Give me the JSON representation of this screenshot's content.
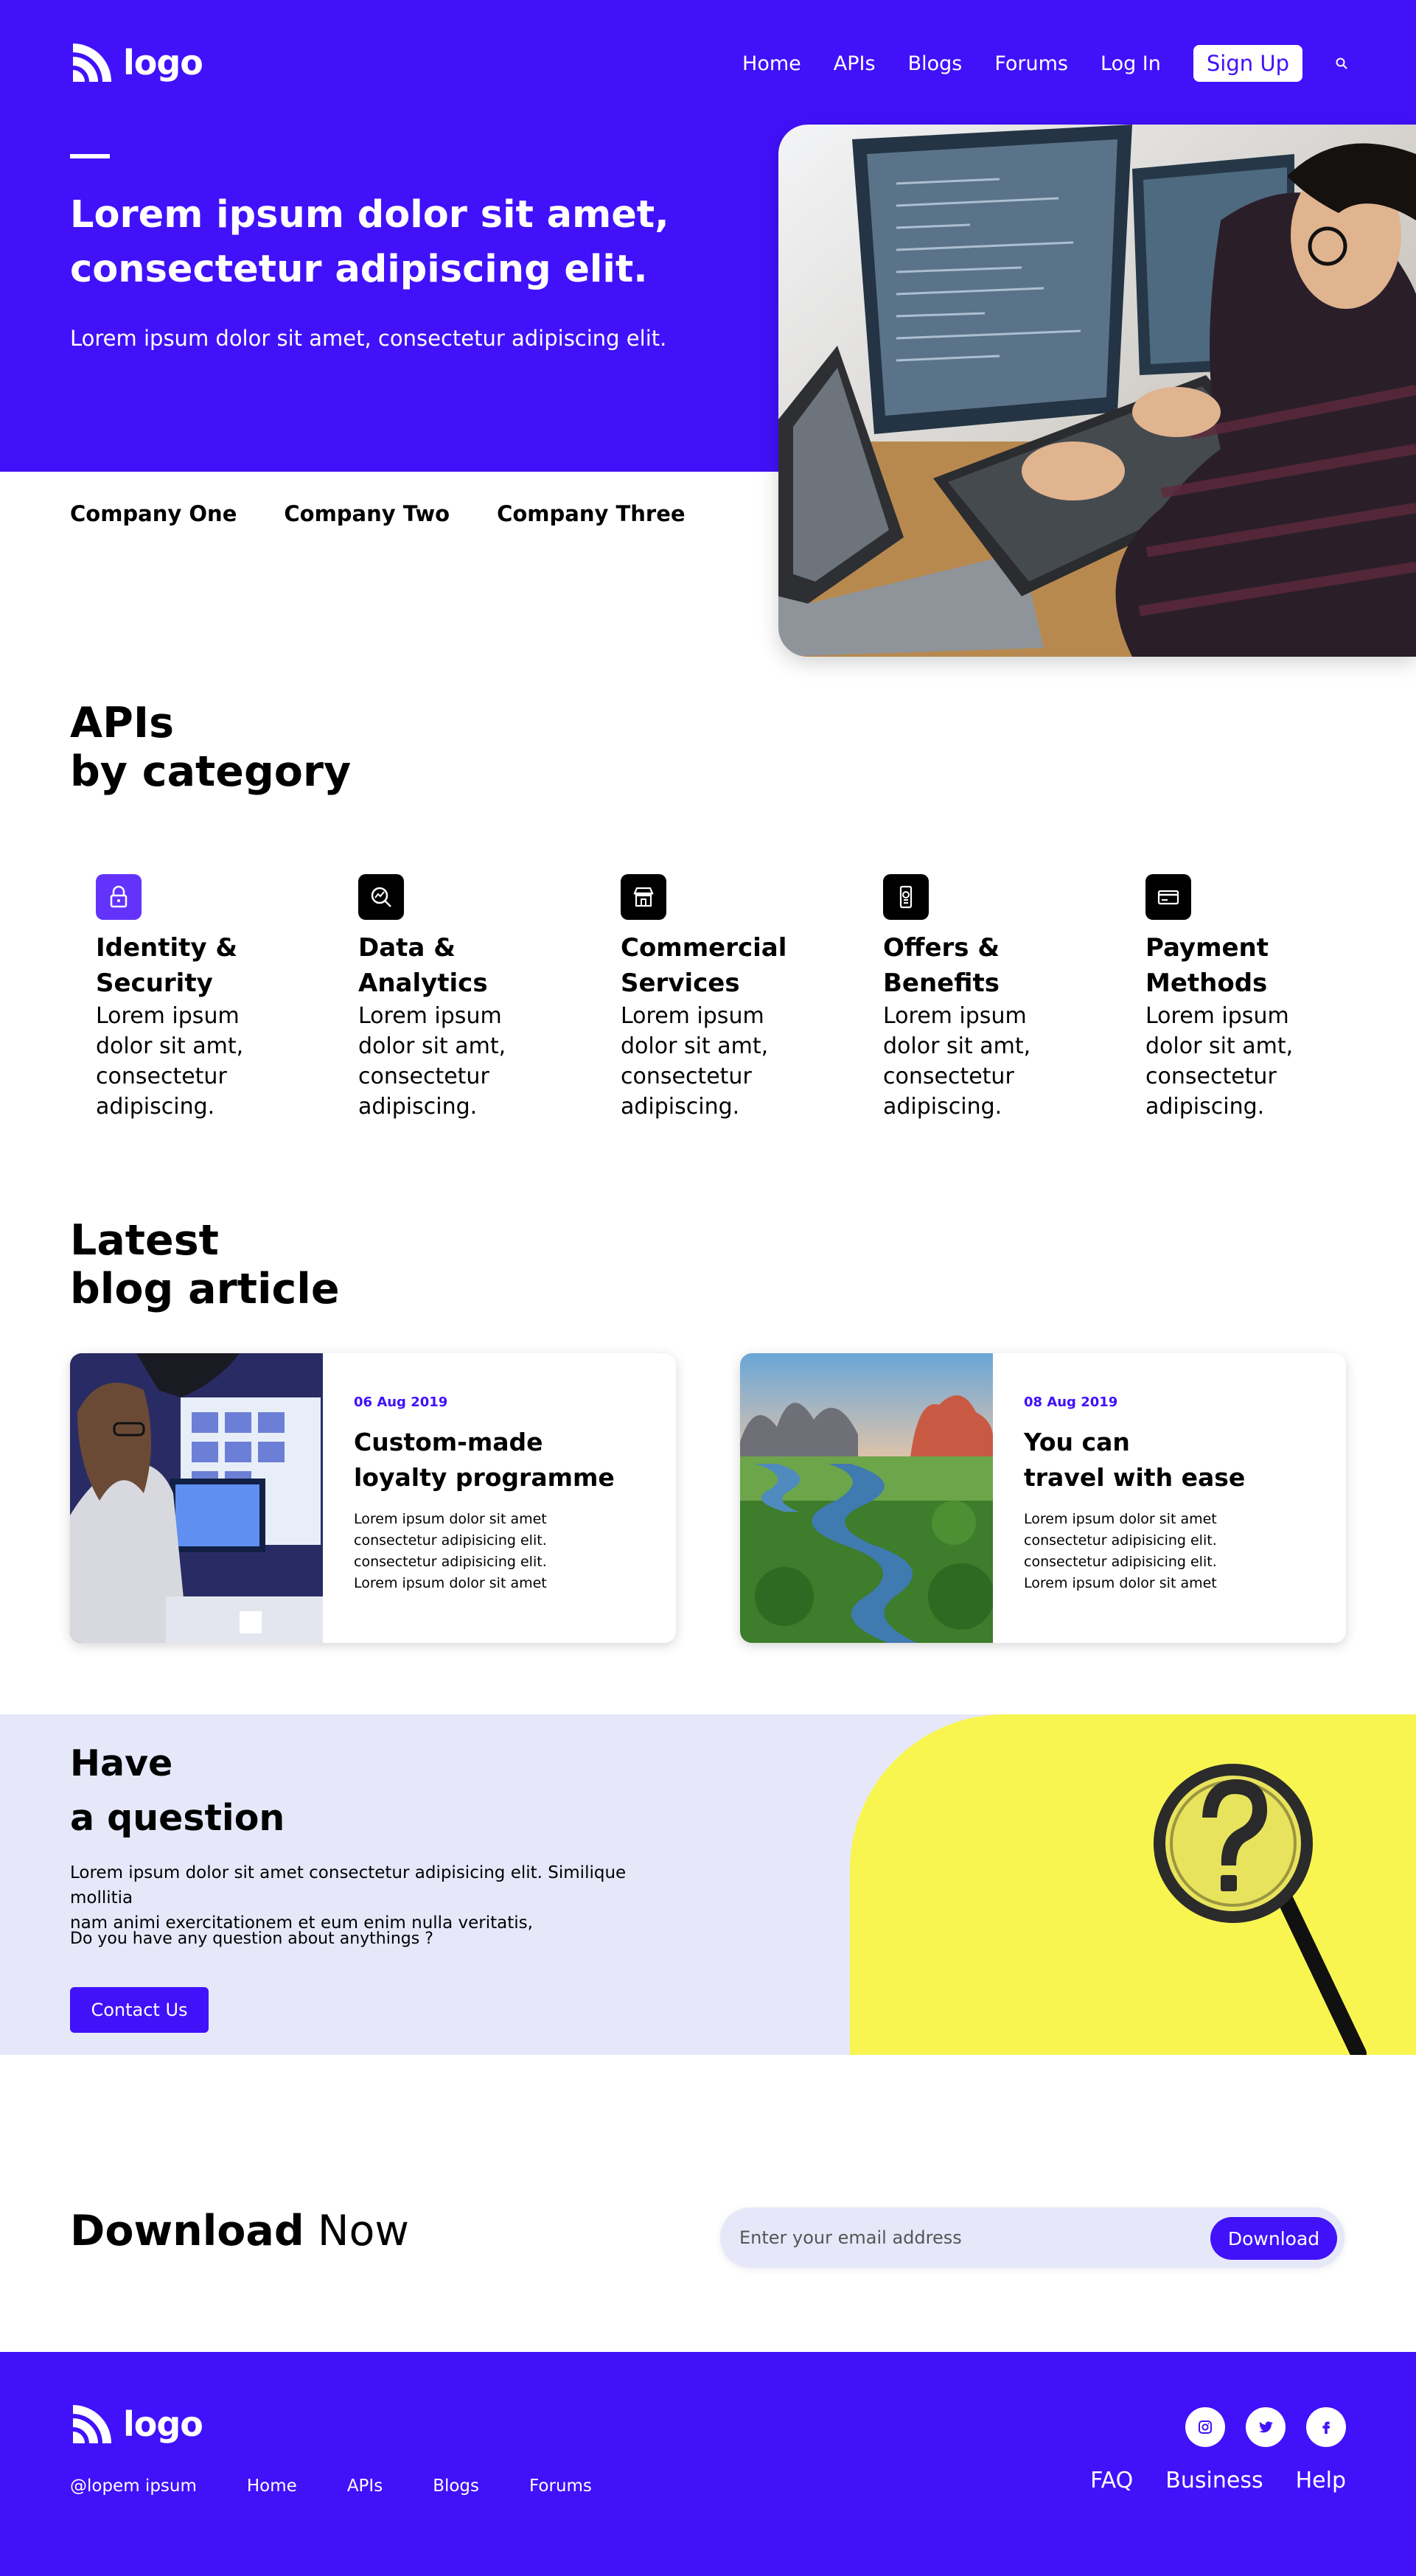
{
  "colors": {
    "brand": "#4111fa",
    "brand_light": "#6433fb",
    "pale": "#e6e8fa",
    "yellow": "#f8f551",
    "white": "#ffffff"
  },
  "header": {
    "logo_text": "logo",
    "nav": [
      "Home",
      "APIs",
      "Blogs",
      "Forums",
      "Log In"
    ],
    "signup": "Sign Up",
    "search_icon": "search-icon"
  },
  "hero": {
    "title_line1": "Lorem ipsum dolor sit amet,",
    "title_line2": "consectetur adipiscing elit.",
    "subtitle": "Lorem ipsum dolor sit amet, consectetur adipiscing elit.",
    "companies": [
      "Company One",
      "Company Two",
      "Company Three"
    ]
  },
  "apis": {
    "title_line1": "APIs",
    "title_line2": "by category",
    "categories": [
      {
        "icon": "lock-icon",
        "title_line1": "Identity &",
        "title_line2": "Security",
        "desc": [
          "Lorem ipsum",
          "dolor sit amt,",
          "consectetur",
          "adipiscing."
        ]
      },
      {
        "icon": "analytics-icon",
        "title_line1": "Data &",
        "title_line2": "Analytics",
        "desc": [
          "Lorem ipsum",
          "dolor sit amt,",
          "consectetur",
          "adipiscing."
        ]
      },
      {
        "icon": "store-icon",
        "title_line1": "Commercial",
        "title_line2": "Services",
        "desc": [
          "Lorem ipsum",
          "dolor sit amt,",
          "consectetur",
          "adipiscing."
        ]
      },
      {
        "icon": "mobile-offer-icon",
        "title_line1": "Offers &",
        "title_line2": "Benefits",
        "desc": [
          "Lorem ipsum",
          "dolor sit amt,",
          "consectetur",
          "adipiscing."
        ]
      },
      {
        "icon": "credit-card-icon",
        "title_line1": "Payment",
        "title_line2": "Methods",
        "desc": [
          "Lorem ipsum",
          "dolor sit amt,",
          "consectetur",
          "adipiscing."
        ]
      }
    ]
  },
  "blog": {
    "title_line1": "Latest",
    "title_line2": "blog article",
    "cards": [
      {
        "date": "06 Aug 2019",
        "title_line1": "Custom-made",
        "title_line2": "loyalty programme",
        "text": [
          "Lorem ipsum dolor sit amet",
          "consectetur adipisicing elit.",
          "consectetur adipisicing elit.",
          "Lorem ipsum dolor sit amet"
        ]
      },
      {
        "date": "08 Aug 2019",
        "title_line1": "You can",
        "title_line2": "travel with ease",
        "text": [
          "Lorem ipsum dolor sit amet",
          "consectetur adipisicing elit.",
          "consectetur adipisicing elit.",
          "Lorem ipsum dolor sit amet"
        ]
      }
    ]
  },
  "question": {
    "title_line1": "Have",
    "title_line2": "a question",
    "text_line1": "Lorem ipsum dolor sit amet consectetur adipisicing elit. Similique mollitia",
    "text_line2": "nam animi exercitationem et eum enim nulla veritatis,",
    "ask": "Do you have any question about anythings ?",
    "button": "Contact Us"
  },
  "download": {
    "title_bold": "Download",
    "title_light": "Now",
    "placeholder": "Enter your email address",
    "button": "Download"
  },
  "footer": {
    "logo_text": "logo",
    "handle": "@lopem ipsum",
    "links": [
      "Home",
      "APIs",
      "Blogs",
      "Forums"
    ],
    "social": [
      "instagram-icon",
      "twitter-icon",
      "facebook-icon"
    ],
    "right_links": [
      "FAQ",
      "Business",
      "Help"
    ]
  }
}
